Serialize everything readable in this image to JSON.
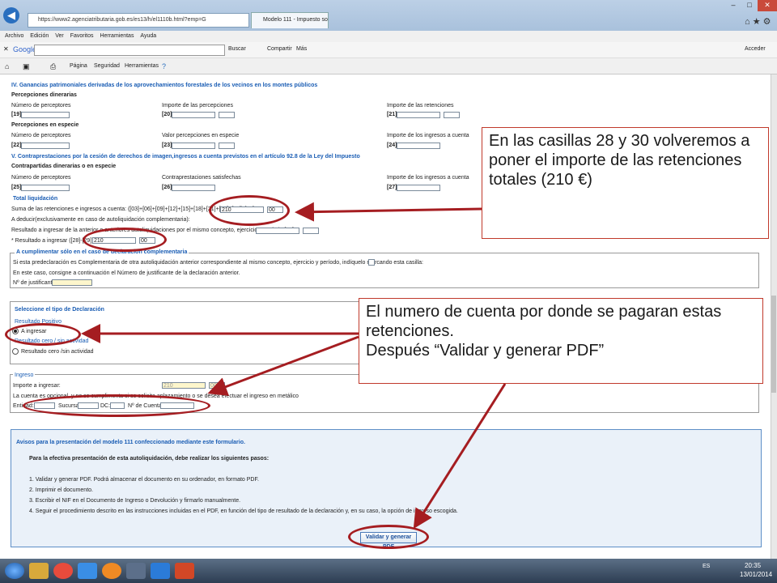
{
  "browser": {
    "url": "https://www2.agenciatributaria.gob.es/es13/h/el1110b.html?emp=G",
    "tab_title": "Modelo 111 - Impuesto sob...",
    "menu": [
      "Archivo",
      "Edición",
      "Ver",
      "Favoritos",
      "Herramientas",
      "Ayuda"
    ],
    "google_label": "Google",
    "buscar_label": "Buscar",
    "compartir_label": "Compartir",
    "mas_label": "Más",
    "acceder_label": "Acceder",
    "cmd_items": [
      "Página",
      "Seguridad",
      "Herramientas"
    ]
  },
  "form": {
    "sec4_title": "IV. Ganancias patrimoniales derivadas de los aprovechamientos forestales de los vecinos en los montes públicos",
    "perc_dinerarias": "Percepciones dinerarias",
    "num_perceptores": "Número de perceptores",
    "importe_percepciones": "Importe de las percepciones",
    "importe_retenciones": "Importe de las retenciones",
    "c19": "[19]",
    "c20": "[20]",
    "c21": "[21]",
    "perc_especie": "Percepciones en especie",
    "valor_especie": "Valor percepciones en especie",
    "importe_ingresos_cuenta": "Importe de los ingresos a cuenta",
    "c22": "[22]",
    "c23": "[23]",
    "c24": "[24]",
    "sec5_title": "V. Contraprestaciones por la cesión de derechos de imagen,ingresos a cuenta previstos en el artículo 92.8 de la Ley del Impuesto",
    "contra_title": "Contrapartidas dinerarias o en especie",
    "contra_satisf": "Contraprestaciones satisfechas",
    "c25": "[25]",
    "c26": "[26]",
    "c27": "[27]",
    "total_title": "Total liquidación",
    "suma_label": "Suma de las retenciones e ingresos a cuenta: ([03]+[06]+[09]+[12]+[15]+[18]+[21]+[24]+[27]) [28]",
    "v28_int": "210",
    "v28_dec": "00",
    "deducir_label": "A deducir(exclusivamente en caso de autoliquidación complementaria):",
    "resultado_anterior": "Resultado a ingresar de la anterior o anteriores autoliquidaciones por el mismo concepto, ejercicio y período [29]",
    "resultado_ingresar": "* Resultado a ingresar ([28]-[29]) [30]",
    "v30_int": "210",
    "v30_dec": "00",
    "complementaria_title": "A cumplimentar sólo en el caso de declaración complementaria",
    "complementaria_text": "Si esta predeclaración es Complementaria de otra autoliquidación anterior correspondiente al mismo concepto, ejercicio y período, indíquelo marcando esta casilla:",
    "justificante_text": "En este caso, consigne a continuación el Número de justificante de la declaración anterior.",
    "n_justificante": "Nº de justificante:",
    "tipo_title": "Seleccione el tipo de Declaración",
    "res_positivo": "Resultado Positivo",
    "a_ingresar": "A ingresar",
    "res_cero": "Resultado cero / sin actividad",
    "res_cero_opt": "Resultado cero /sin actividad",
    "ingreso_title": "Ingreso",
    "importe_ingresar": "Importe a ingresar:",
    "ingreso_int": "210",
    "ingreso_dec": "00",
    "cuenta_text": "La cuenta es opcional, y no se cumplimenta si se solicita aplazamiento o se desea efectuar el ingreso en metálico",
    "entidad": "Entidad:",
    "sucursal": "Sucursal:",
    "dc": "DC:",
    "n_cuenta": "Nº de Cuenta:",
    "avisos_title": "Avisos para la presentación del modelo 111 confeccionado mediante este formulario.",
    "pasos_intro": "Para la efectiva presentación de esta autoliquidación, debe realizar los siguientes pasos:",
    "pasos": [
      "1. Validar y generar PDF. Podrá almacenar el documento en su ordenador, en formato PDF.",
      "2. Imprimir el documento.",
      "3. Escribir el NIF en el Documento de Ingreso o Devolución y firmarlo manualmente.",
      "4. Seguir el procedimiento descrito en las instrucciones incluidas en el PDF, en función del tipo de resultado de la declaración y, en su caso, la opción de ingreso escogida."
    ],
    "btn_pdf": "Validar y generar PDF"
  },
  "callouts": {
    "top": "En las casillas 28 y 30 volveremos a poner el importe de las retenciones totales (210 €)",
    "bottom_1": "El numero de cuenta por donde se pagaran estas retenciones.",
    "bottom_2": "Después “Validar y generar PDF”"
  },
  "taskbar": {
    "lang": "ES",
    "time": "20:35",
    "date": "13/01/2014"
  },
  "colors": {
    "annotation": "#a51d21",
    "section": "#1a5db4"
  }
}
